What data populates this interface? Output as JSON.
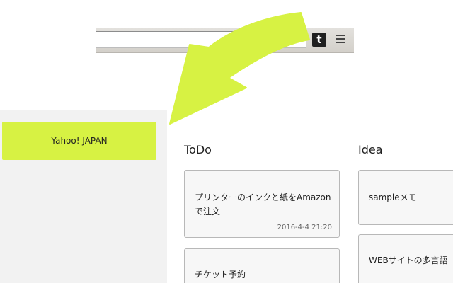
{
  "browser": {
    "star_icon": "star-icon",
    "extension_icon_letter": "t",
    "menu_icon": "hamburger-menu-icon"
  },
  "sidebar": {
    "bookmark_label": "Yahoo! JAPAN"
  },
  "columns": {
    "todo_title": "ToDo",
    "idea_title": "Idea"
  },
  "todo_cards": [
    {
      "text": "プリンターのインクと紙をAmazonで注文",
      "date": "2016-4-4 21:20"
    },
    {
      "text": "チケット予約",
      "date": ""
    }
  ],
  "idea_cards": [
    {
      "text": "sampleメモ"
    },
    {
      "text": "WEBサイトの多言語"
    }
  ],
  "colors": {
    "accent": "#d7f243",
    "sidebar_bg": "#f2f2f2"
  }
}
